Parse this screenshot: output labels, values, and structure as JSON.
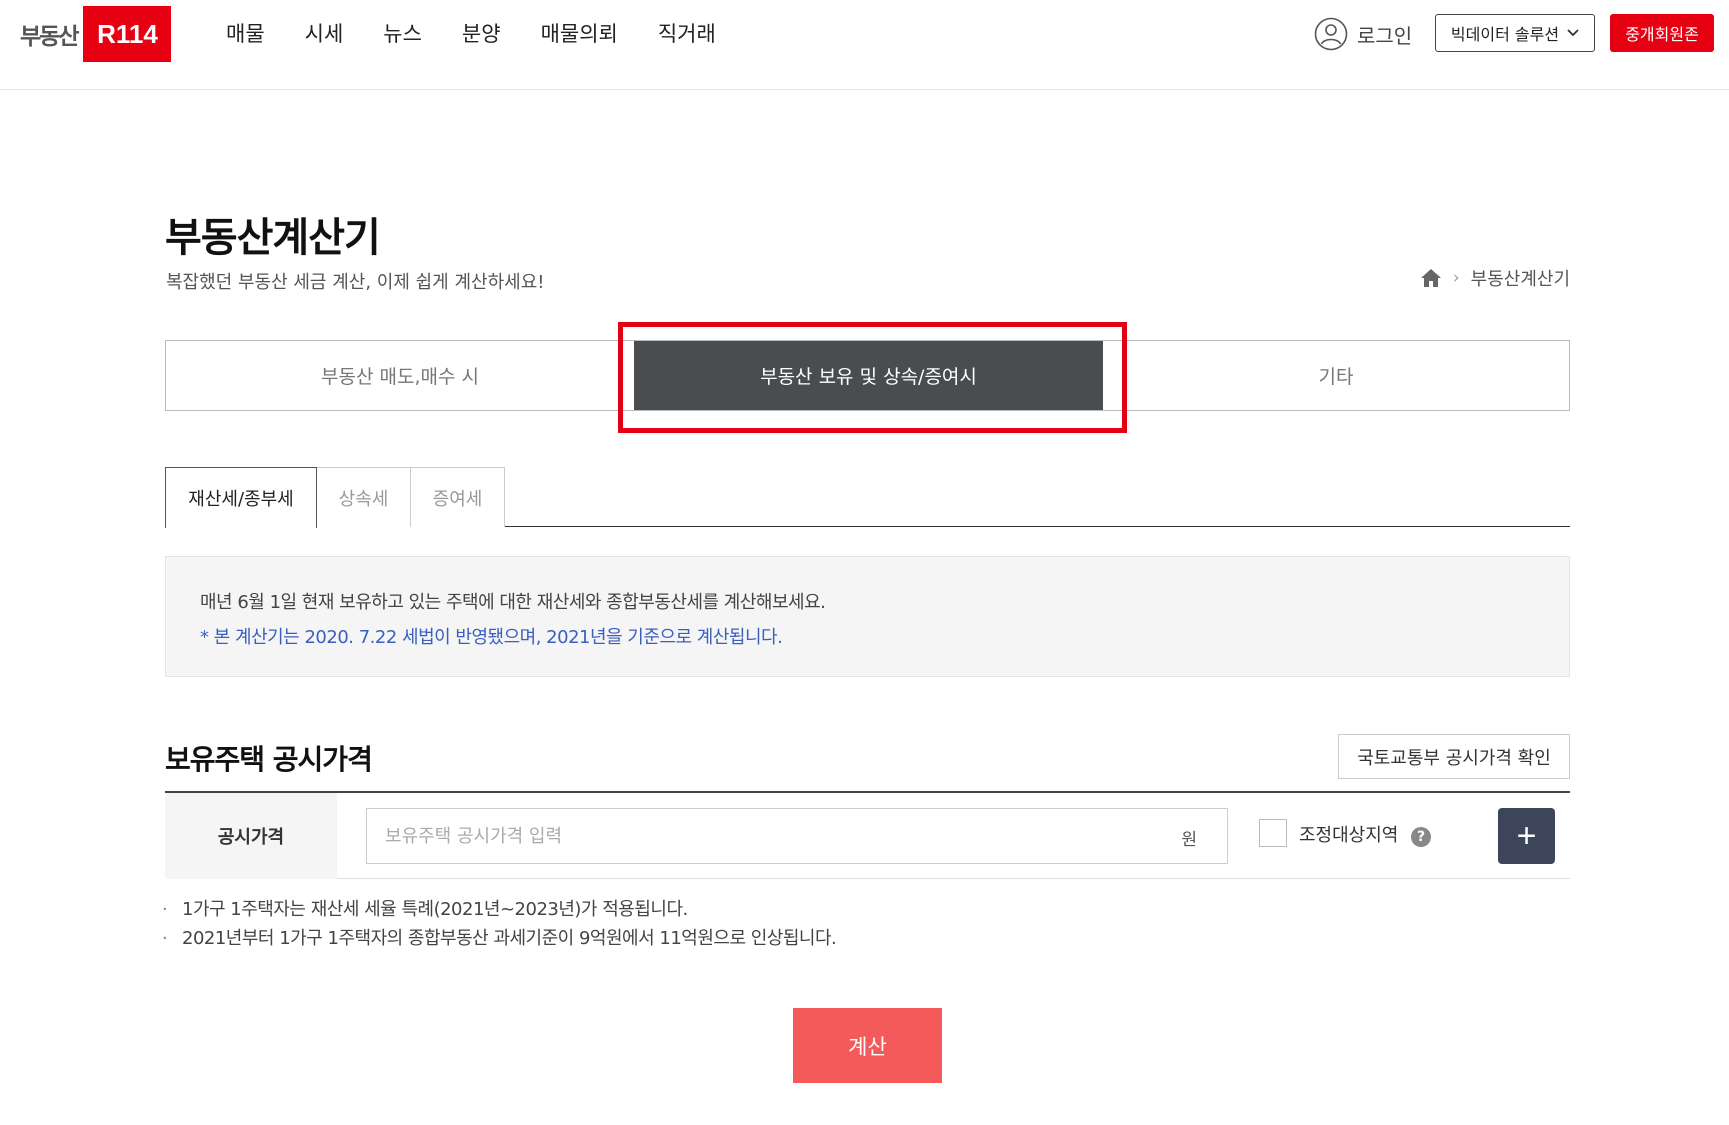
{
  "header": {
    "logo_text": "부동산",
    "logo_box": "R114",
    "nav": [
      "매물",
      "시세",
      "뉴스",
      "분양",
      "매물의뢰",
      "직거래"
    ],
    "login_label": "로그인",
    "bigdata_label": "빅데이터 솔루션",
    "member_label": "중개회원존"
  },
  "page": {
    "title": "부동산계산기",
    "subtitle": "복잡했던 부동산 세금 계산, 이제 쉽게 계산하세요!",
    "breadcrumb_current": "부동산계산기"
  },
  "main_tabs": [
    "부동산 매도,매수 시",
    "부동산 보유 및 상속/증여시",
    "기타"
  ],
  "sub_tabs": [
    "재산세/종부세",
    "상속세",
    "증여세"
  ],
  "info": {
    "line1": "매년 6월 1일 현재 보유하고 있는 주택에 대한 재산세와 종합부동산세를 계산해보세요.",
    "line2": "* 본 계산기는 2020. 7.22 세법이 반영됐으며, 2021년을 기준으로 계산됩니다."
  },
  "section": {
    "title": "보유주택 공시가격",
    "molit_button": "국토교통부 공시가격 확인",
    "field_label": "공시가격",
    "input_placeholder": "보유주택 공시가격 입력",
    "input_value": "",
    "unit": "원",
    "checkbox_label": "조정대상지역",
    "help": "?",
    "add": "+"
  },
  "notes": [
    "1가구 1주택자는 재산세 세율 특례(2021년~2023년)가 적용됩니다.",
    "2021년부터 1가구 1주택자의 종합부동산 과세기준이 9억원에서 11억원으로 인상됩니다."
  ],
  "calc_label": "계산",
  "colors": {
    "brand_red": "#e60012",
    "active_tab": "#4a4d50",
    "info_blue": "#3a5fbf",
    "add_button": "#3c4559",
    "calc_button": "#f45a5a"
  }
}
